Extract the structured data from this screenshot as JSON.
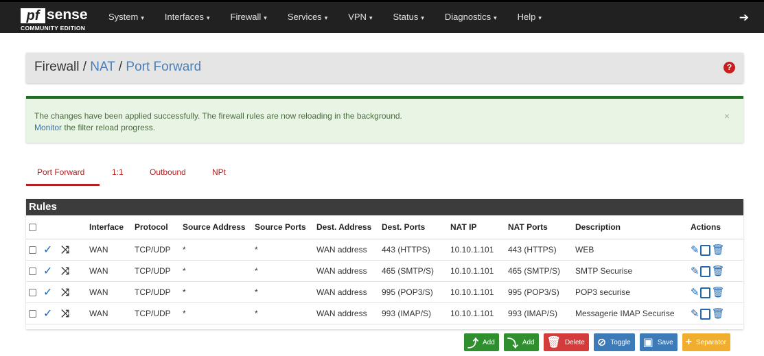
{
  "navbar": {
    "logo_mark": "pf",
    "logo_word": "sense",
    "logo_sub": "COMMUNITY EDITION",
    "items": [
      {
        "label": "System"
      },
      {
        "label": "Interfaces"
      },
      {
        "label": "Firewall"
      },
      {
        "label": "Services"
      },
      {
        "label": "VPN"
      },
      {
        "label": "Status"
      },
      {
        "label": "Diagnostics"
      },
      {
        "label": "Help"
      }
    ],
    "logout_icon": "sign-out-icon"
  },
  "breadcrumb": {
    "root": "Firewall",
    "sep": "/",
    "middle": "NAT",
    "current": "Port Forward",
    "help_icon": "question-circle-icon"
  },
  "alert": {
    "message": "The changes have been applied successfully. The firewall rules are now reloading in the background.",
    "link": "Monitor",
    "message_rest": "the filter reload progress.",
    "close": "×"
  },
  "tabs": [
    {
      "label": "Port Forward",
      "active": true
    },
    {
      "label": "1:1"
    },
    {
      "label": "Outbound"
    },
    {
      "label": "NPt"
    }
  ],
  "rules": {
    "title": "Rules",
    "columns": [
      "",
      "",
      "",
      "Interface",
      "Protocol",
      "Source Address",
      "Source Ports",
      "Dest. Address",
      "Dest. Ports",
      "NAT IP",
      "NAT Ports",
      "Description",
      "Actions"
    ],
    "rows": [
      {
        "interface": "WAN",
        "protocol": "TCP/UDP",
        "src_addr": "*",
        "src_ports": "*",
        "dest_addr": "WAN address",
        "dest_ports": "443 (HTTPS)",
        "nat_ip": "10.10.1.101",
        "nat_ports": "443 (HTTPS)",
        "description": "WEB"
      },
      {
        "interface": "WAN",
        "protocol": "TCP/UDP",
        "src_addr": "*",
        "src_ports": "*",
        "dest_addr": "WAN address",
        "dest_ports": "465 (SMTP/S)",
        "nat_ip": "10.10.1.101",
        "nat_ports": "465 (SMTP/S)",
        "description": "SMTP Securise"
      },
      {
        "interface": "WAN",
        "protocol": "TCP/UDP",
        "src_addr": "*",
        "src_ports": "*",
        "dest_addr": "WAN address",
        "dest_ports": "995 (POP3/S)",
        "nat_ip": "10.10.1.101",
        "nat_ports": "995 (POP3/S)",
        "description": "POP3 securise"
      },
      {
        "interface": "WAN",
        "protocol": "TCP/UDP",
        "src_addr": "*",
        "src_ports": "*",
        "dest_addr": "WAN address",
        "dest_ports": "993 (IMAP/S)",
        "nat_ip": "10.10.1.101",
        "nat_ports": "993 (IMAP/S)",
        "description": "Messagerie IMAP Securise"
      }
    ]
  },
  "buttons": {
    "add_top": "Add",
    "add_bottom": "Add",
    "delete": "Delete",
    "toggle": "Toggle",
    "save": "Save",
    "separator": "Separator"
  },
  "colors": {
    "navbar": "#212121",
    "accent_red": "#b22222",
    "success_bar": "#1d6e23",
    "success_bg": "#e8f4e4",
    "link_blue": "#4a7fb5",
    "btn_green": "#2f8f2f",
    "btn_red": "#d43c3c",
    "btn_blue": "#3d7ab8",
    "btn_orange": "#f0ad2e"
  }
}
